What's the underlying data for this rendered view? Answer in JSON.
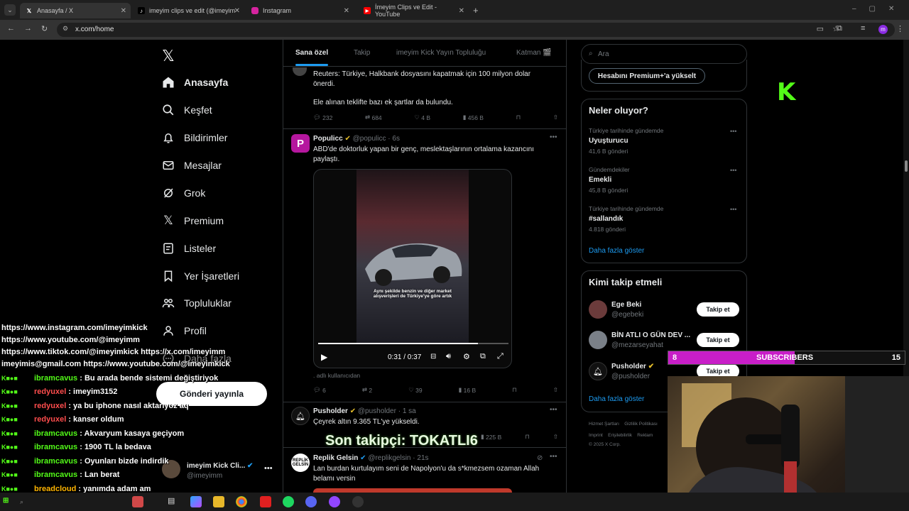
{
  "browser": {
    "tabs": [
      {
        "title": "Anasayfa / X",
        "icon": "x-logo-icon"
      },
      {
        "title": "imeyim clips ve edit (@imeyim",
        "icon": "tiktok-icon"
      },
      {
        "title": "Instagram",
        "icon": "instagram-icon"
      },
      {
        "title": "İmeyim Clips ve Edit - YouTube",
        "icon": "youtube-icon"
      }
    ],
    "url": "x.com/home"
  },
  "nav": {
    "items": [
      {
        "label": "Anasayfa",
        "icon": "home-icon"
      },
      {
        "label": "Keşfet",
        "icon": "search-icon"
      },
      {
        "label": "Bildirimler",
        "icon": "bell-icon"
      },
      {
        "label": "Mesajlar",
        "icon": "mail-icon"
      },
      {
        "label": "Grok",
        "icon": "grok-icon"
      },
      {
        "label": "Premium",
        "icon": "x-logo-icon"
      },
      {
        "label": "Listeler",
        "icon": "list-icon"
      },
      {
        "label": "Yer İşaretleri",
        "icon": "bookmark-icon"
      },
      {
        "label": "Topluluklar",
        "icon": "communities-icon"
      },
      {
        "label": "Profil",
        "icon": "profile-icon"
      },
      {
        "label": "Daha fazla",
        "icon": "more-icon"
      }
    ],
    "post_button": "Gönderi yayınla",
    "account": {
      "name": "imeyim Kick Cli...",
      "handle": "@imeyimm"
    }
  },
  "feed": {
    "tabs": [
      "Sana özel",
      "Takip",
      "imeyim Kick Yayın Topluluğu",
      "Katman 🎬"
    ],
    "tweets": [
      {
        "text1": "Reuters: Türkiye, Halkbank dosyasını kapatmak için 100 milyon dolar önerdi.",
        "text2": "Ele alınan teklifte bazı ek şartlar da bulundu.",
        "replies": "232",
        "reposts": "684",
        "likes": "4 B",
        "views": "456 B"
      },
      {
        "author": "Populicc",
        "handle": "@populicc",
        "time": "6s",
        "text": "ABD'de doktorluk yapan bir genç, meslektaşlarının ortalama kazancını paylaştı.",
        "video_caption": "Aynı şekilde benzin ve diğer market alışverişleri de Türkiye'ye göre artık",
        "video_time": "0:31 / 0:37",
        "video_progress": 0.84,
        "note": "adlı kullanıcıdan",
        "replies": "6",
        "reposts": "2",
        "likes": "39",
        "views": "16 B"
      },
      {
        "author": "Pusholder",
        "handle": "@pusholder",
        "time": "1 sa",
        "text": "Çeyrek altın 9.365 TL'ye yükseldi.",
        "views": "225 B"
      },
      {
        "author": "Replik Gelsin",
        "handle": "@replikgelsin",
        "time": "21s",
        "text": "Lan burdan kurtulayım seni de Napolyon'u da s*kmezsem ozaman Allah belamı versin"
      }
    ]
  },
  "sidebar": {
    "search_placeholder": "Ara",
    "premium_button": "Hesabını Premium+'a yükselt",
    "trends_title": "Neler oluyor?",
    "trends": [
      {
        "context": "Türkiye tarihinde gündemde",
        "name": "Uyuşturucu",
        "count": "41,6 B gönderi"
      },
      {
        "context": "Gündemdekiler",
        "name": "Emekli",
        "count": "45,8 B gönderi"
      },
      {
        "context": "Türkiye tarihinde gündemde",
        "name": "#sallandık",
        "count": "4.818 gönderi"
      }
    ],
    "show_more": "Daha fazla göster",
    "who_title": "Kimi takip etmeli",
    "who": [
      {
        "name": "Ege Beki",
        "handle": "@egebeki"
      },
      {
        "name": "BİN ATLI O GÜN DEV ...",
        "handle": "@mezarseyahat"
      },
      {
        "name": "Pusholder",
        "handle": "@pusholder"
      }
    ],
    "follow_label": "Takip et",
    "who_more": "Daha fazla göster",
    "footer": [
      "Hizmet Şartları",
      "Gizlilik Politikası",
      "Imprint",
      "Erişilebilirlik",
      "Reklam",
      "© 2025 X Corp."
    ]
  },
  "overlay": {
    "socials": [
      "https://www.instagram.com/imeyimkick",
      "https://www.youtube.com/@imeyimm",
      "https://www.tiktok.com/@imeyimkick https://x.com/imeyimm",
      "imeyimis@gmail.com https://www.youtube.com/@imeyimkick"
    ],
    "chat": [
      {
        "user": "ibramcavus",
        "msg": ": Bu arada bende sistemi değiştiriyok",
        "color": "#53fc18"
      },
      {
        "user": "redyuxel",
        "msg": ": imeyim3152",
        "color": "#ff4d4d"
      },
      {
        "user": "redyuxel",
        "msg": ": ya bu iphone nasıl aktarıyoz aq",
        "color": "#ff4d4d"
      },
      {
        "user": "redyuxel",
        "msg": ": kanser oldum",
        "color": "#ff4d4d"
      },
      {
        "user": "ibramcavus",
        "msg": ": Akvaryum kasaya geçiyom",
        "color": "#53fc18"
      },
      {
        "user": "ibramcavus",
        "msg": ": 1900 TL la bedava",
        "color": "#53fc18"
      },
      {
        "user": "ibramcavus",
        "msg": ": Oyunları bizde indirdik",
        "color": "#53fc18"
      },
      {
        "user": "ibramcavus",
        "msg": ": Lan berat",
        "color": "#53fc18"
      },
      {
        "user": "breadcloud",
        "msg": ": yanımda adam am",
        "color": "#ffb400"
      }
    ],
    "last_follower": "Son takipçi: TOKATLI6",
    "subs": {
      "left": "8",
      "label": "SUBSCRIBERS",
      "right": "15"
    },
    "kick_logo": "K",
    "colors": {
      "kick": "#53fc18",
      "x_blue": "#1d9bf0",
      "subs_fill": "#c81ec8"
    }
  }
}
